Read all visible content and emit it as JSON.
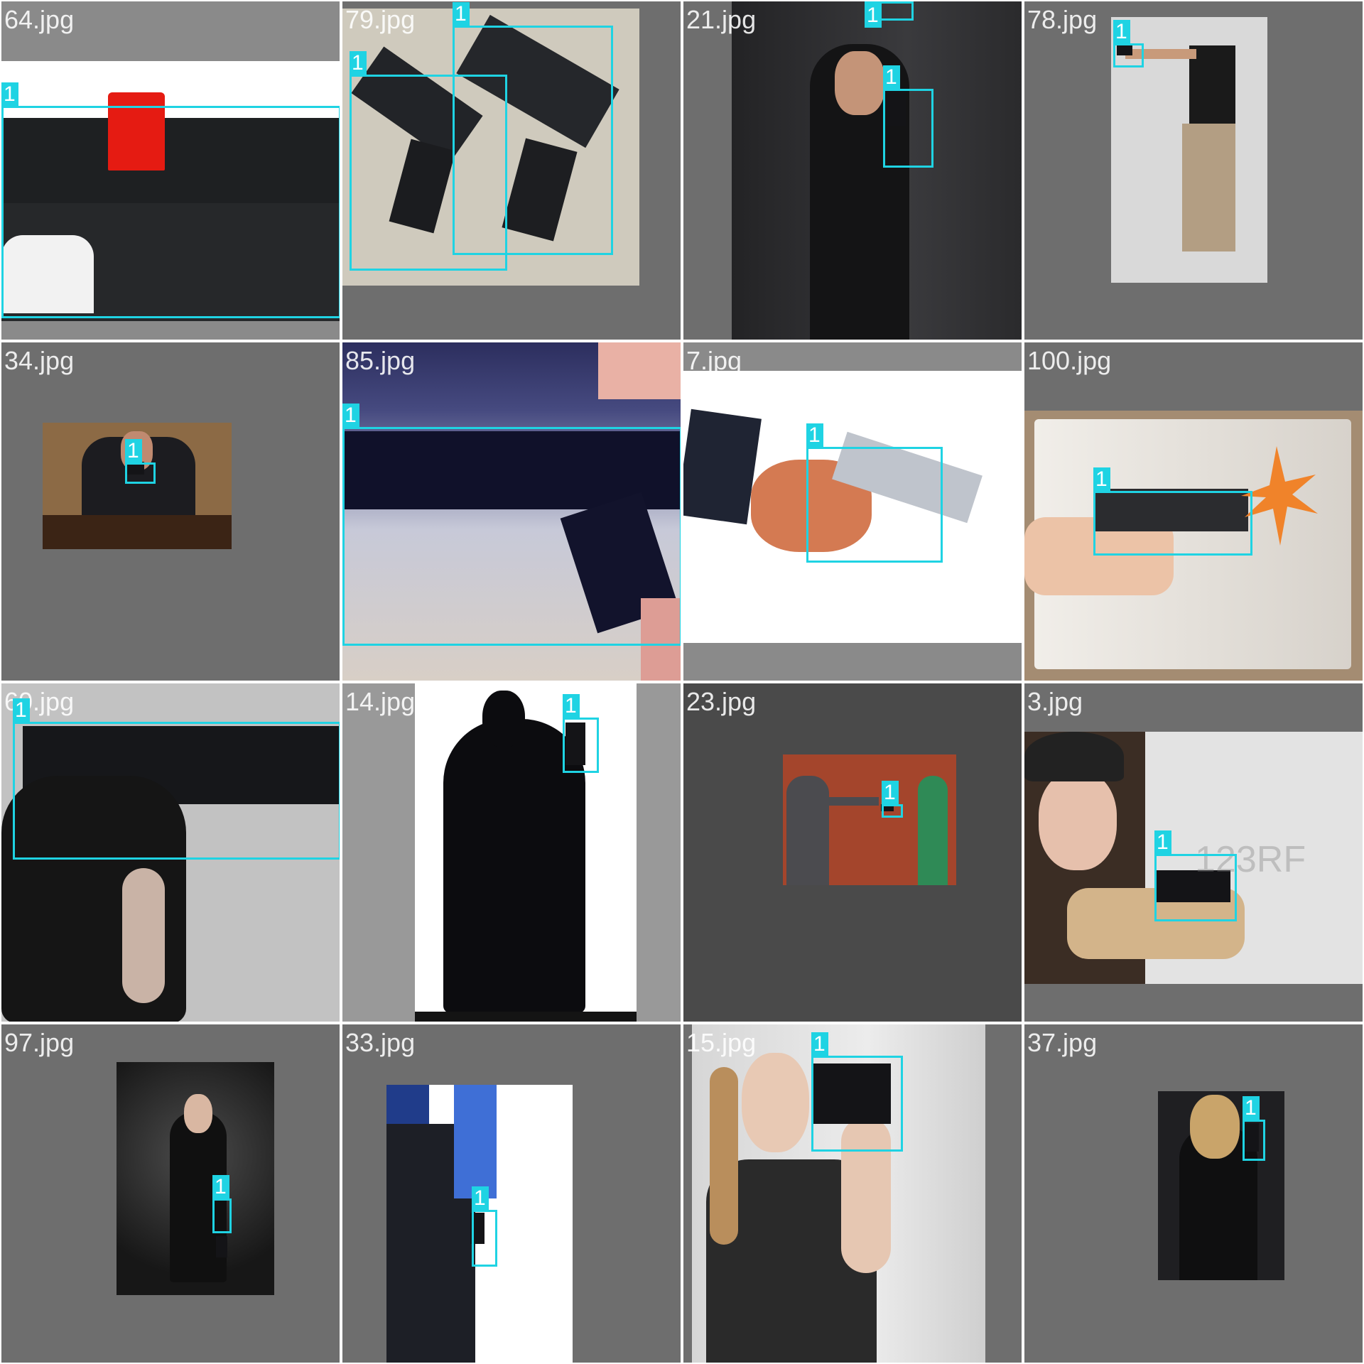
{
  "colors": {
    "box": "#1fd3e3",
    "label_text": "#ffffff",
    "tile_background": "#6e6e6e",
    "separator": "#ffffff"
  },
  "detection_label": "1",
  "tiles": [
    {
      "filename": "64.jpg"
    },
    {
      "filename": "79.jpg"
    },
    {
      "filename": "21.jpg"
    },
    {
      "filename": "78.jpg"
    },
    {
      "filename": "34.jpg"
    },
    {
      "filename": "85.jpg"
    },
    {
      "filename": "7.jpg"
    },
    {
      "filename": "100.jpg"
    },
    {
      "filename": "60.jpg"
    },
    {
      "filename": "14.jpg"
    },
    {
      "filename": "23.jpg"
    },
    {
      "filename": "3.jpg"
    },
    {
      "filename": "97.jpg"
    },
    {
      "filename": "33.jpg"
    },
    {
      "filename": "15.jpg"
    },
    {
      "filename": "37.jpg"
    }
  ],
  "watermarks": {
    "brand_123rf": "123RF"
  }
}
